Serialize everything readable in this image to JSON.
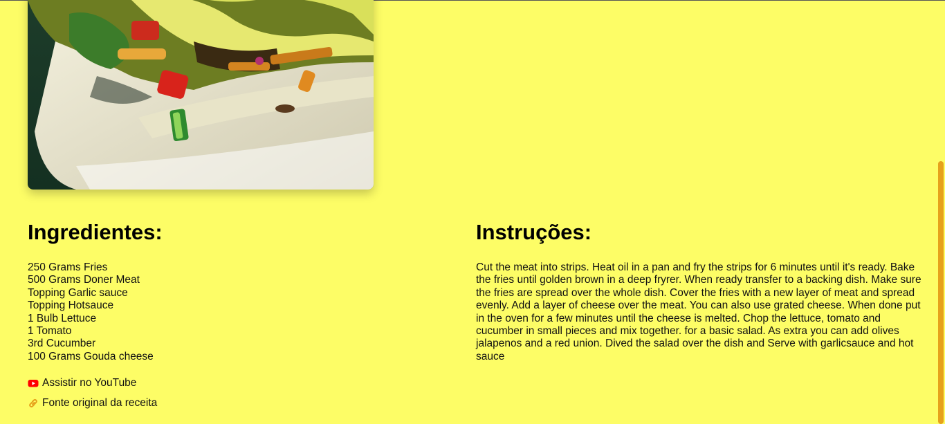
{
  "photo": {
    "alt_semantic": "recipe-dish-photo"
  },
  "ingredients": {
    "heading": "Ingredientes:",
    "items": [
      "250 Grams Fries",
      "500 Grams Doner Meat",
      "Topping Garlic sauce",
      "Topping Hotsauce",
      "1 Bulb Lettuce",
      "1 Tomato",
      "3rd Cucumber",
      "100 Grams Gouda cheese"
    ]
  },
  "links": {
    "youtube_label": "Assistir no YouTube",
    "source_label": "Fonte original da receita"
  },
  "instructions": {
    "heading": "Instruções:",
    "text": "Cut the meat into strips. Heat oil in a pan and fry the strips for 6 minutes until it's ready. Bake the fries until golden brown in a deep fryrer. When ready transfer to a backing dish. Make sure the fries are spread over the whole dish. Cover the fries with a new layer of meat and spread evenly. Add a layer of cheese over the meat. You can also use grated cheese. When done put in the oven for a few minutes until the cheese is melted. Chop the lettuce, tomato and cucumber in small pieces and mix together. for a basic salad. As extra you can add olives jalapenos and a red union. Dived the salad over the dish and Serve with garlicsauce and hot sauce"
  },
  "colors": {
    "page_background": "#fdfd66",
    "scrollbar_thumb": "#e6a21c",
    "youtube_red": "#ff0000",
    "link_icon": "#e6a21c"
  },
  "icons": {
    "youtube": "youtube-icon",
    "link": "link-icon"
  }
}
